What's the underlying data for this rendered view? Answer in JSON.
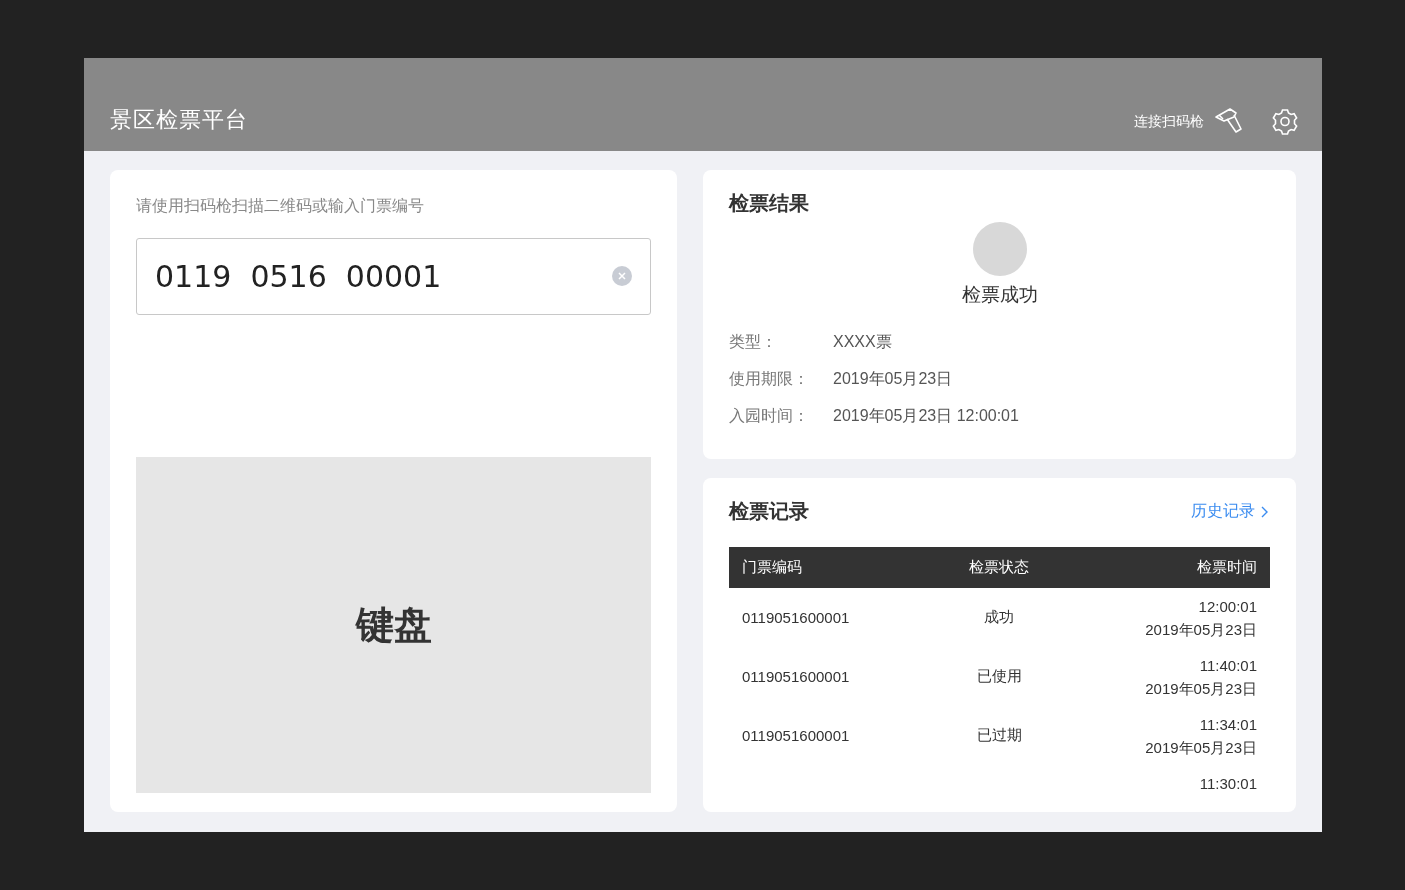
{
  "header": {
    "title": "景区检票平台",
    "scanner_label": "连接扫码枪"
  },
  "scan": {
    "instruction": "请使用扫码枪扫描二维码或输入门票编号",
    "value": "0119  0516  00001",
    "keyboard_label": "键盘"
  },
  "result": {
    "title": "检票结果",
    "status": "检票成功",
    "fields": [
      {
        "label": "类型：",
        "value": "XXXX票"
      },
      {
        "label": "使用期限：",
        "value": "2019年05月23日"
      },
      {
        "label": "入园时间：",
        "value": "2019年05月23日  12:00:01"
      }
    ]
  },
  "records": {
    "title": "检票记录",
    "history_link": "历史记录",
    "columns": [
      "门票编码",
      "检票状态",
      "检票时间"
    ],
    "rows": [
      {
        "code": "0119051600001",
        "status": "成功",
        "time": "12:00:01",
        "date": "2019年05月23日"
      },
      {
        "code": "0119051600001",
        "status": "已使用",
        "time": "11:40:01",
        "date": "2019年05月23日"
      },
      {
        "code": "0119051600001",
        "status": "已过期",
        "time": "11:34:01",
        "date": "2019年05月23日"
      },
      {
        "time": "11:30:01"
      }
    ]
  }
}
